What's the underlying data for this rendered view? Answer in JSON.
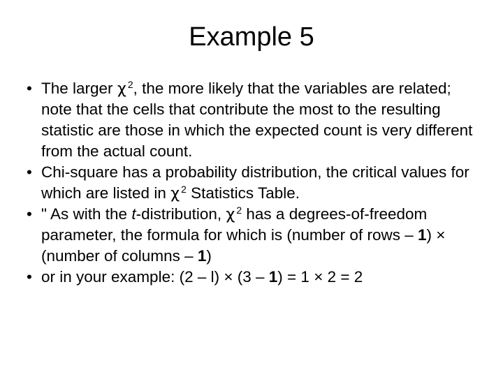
{
  "slide": {
    "title": "Example 5",
    "bullet_marker": "•",
    "bullets": [
      {
        "id": "bullet-1",
        "text": "The larger χ 2, the more likely that the variables are related; note that the cells that contribute the most to the resulting statistic are those in which the expected count is very different from the actual count.",
        "parts": [
          {
            "t": "The larger ",
            "style": "normal"
          },
          {
            "t": "χ",
            "style": "chi"
          },
          {
            "t": "2",
            "style": "sup"
          },
          {
            "t": ", the more likely that the variables are related; note that the cells that contribute the most to the resulting statistic are those in which the expected count is very different from the actual count.",
            "style": "normal"
          }
        ]
      },
      {
        "id": "bullet-2",
        "text": "Chi-square has a probability distribution, the critical values for which are listed in χ 2  Statistics Table.",
        "parts": [
          {
            "t": "Chi-square has a probability distribution, the critical values for which are listed in ",
            "style": "normal"
          },
          {
            "t": "χ",
            "style": "chi"
          },
          {
            "t": "2",
            "style": "sup"
          },
          {
            "t": "  Statistics Table.",
            "style": "normal"
          }
        ]
      },
      {
        "id": "bullet-3",
        "text": "\" As with the t-distribution, χ 2 has a degrees-of-freedom parameter, the formula for which is (number of rows – 1) × (number of columns – 1)",
        "parts": [
          {
            "t": "\" As with the ",
            "style": "normal"
          },
          {
            "t": "t",
            "style": "italic"
          },
          {
            "t": "-distribution, ",
            "style": "normal"
          },
          {
            "t": "χ",
            "style": "chi"
          },
          {
            "t": "2",
            "style": "sup"
          },
          {
            "t": " has a degrees-of-freedom parameter, the formula for which is (number of rows – ",
            "style": "normal"
          },
          {
            "t": "1",
            "style": "bold"
          },
          {
            "t": ") × (number of columns – ",
            "style": "normal"
          },
          {
            "t": "1",
            "style": "bold"
          },
          {
            "t": ")",
            "style": "normal"
          }
        ]
      },
      {
        "id": "bullet-4",
        "text": "or in your example: (2 – l) × (3 – 1) = 1 × 2 = 2",
        "parts": [
          {
            "t": "or in your example: (2 – l) × (3 – ",
            "style": "normal"
          },
          {
            "t": "1",
            "style": "bold"
          },
          {
            "t": ") = 1 × 2 = 2",
            "style": "normal"
          }
        ]
      }
    ]
  },
  "colors": {
    "background": "#ffffff",
    "text": "#000000"
  }
}
